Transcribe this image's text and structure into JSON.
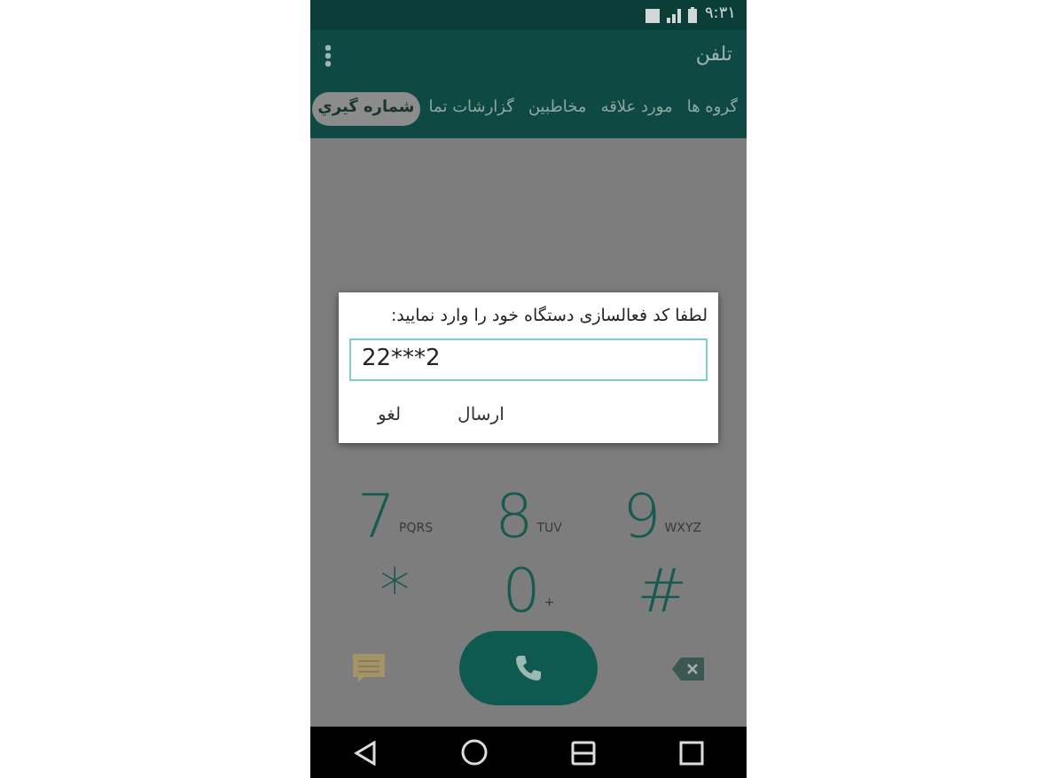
{
  "status_bar": {
    "time": "۹:۳۱"
  },
  "app_bar": {
    "title": "تلفن"
  },
  "tabs": [
    {
      "label": "گروه ها",
      "selected": false
    },
    {
      "label": "مورد علاقه",
      "selected": false
    },
    {
      "label": "مخاطبين",
      "selected": false
    },
    {
      "label": "گزارشات تما",
      "selected": false
    },
    {
      "label": "شماره گيري",
      "selected": true
    }
  ],
  "keypad": [
    [
      {
        "digit": "9",
        "letters": "WXYZ"
      },
      {
        "digit": "8",
        "letters": "TUV"
      },
      {
        "digit": "7",
        "letters": "PQRS"
      }
    ],
    [
      {
        "digit": "#"
      },
      {
        "digit": "0",
        "letters": "+"
      },
      {
        "digit": "*"
      }
    ]
  ],
  "dialog": {
    "message": "لطفا کد فعالسازی دستگاه خود را وارد نمایید:",
    "value": "22***2",
    "buttons": [
      "ارسال",
      "لغو"
    ]
  }
}
